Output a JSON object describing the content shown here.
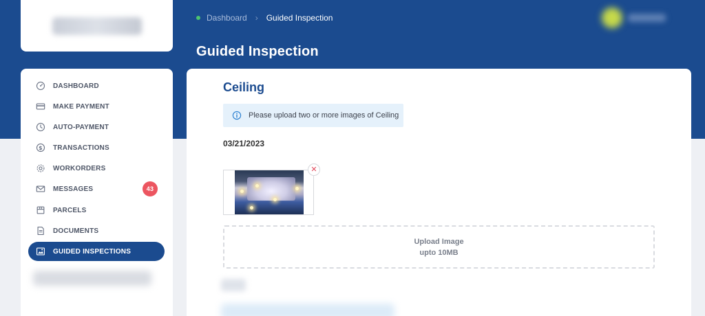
{
  "header": {
    "breadcrumb": {
      "home": "Dashboard",
      "current": "Guided Inspection"
    },
    "page_title": "Guided Inspection"
  },
  "sidebar": {
    "items": [
      {
        "label": "DASHBOARD",
        "icon": "dashboard-gauge-icon"
      },
      {
        "label": "MAKE PAYMENT",
        "icon": "credit-card-icon"
      },
      {
        "label": "AUTO-PAYMENT",
        "icon": "clock-icon"
      },
      {
        "label": "TRANSACTIONS",
        "icon": "dollar-circle-icon"
      },
      {
        "label": "WORKORDERS",
        "icon": "gear-icon"
      },
      {
        "label": "MESSAGES",
        "icon": "envelope-icon",
        "badge": "43"
      },
      {
        "label": "PARCELS",
        "icon": "parcel-icon"
      },
      {
        "label": "DOCUMENTS",
        "icon": "document-icon"
      },
      {
        "label": "GUIDED INSPECTIONS",
        "icon": "inspection-image-icon",
        "active": true
      }
    ]
  },
  "main": {
    "section_title": "Ceiling",
    "info_message": "Please upload two or more images of Ceiling",
    "date": "03/21/2023",
    "upload": {
      "line1": "Upload Image",
      "line2": "upto 10MB"
    }
  },
  "colors": {
    "brand": "#1b4b8f",
    "badge": "#ec5560",
    "info_bg": "#e5f1fb",
    "status_dot": "#4cc46f"
  }
}
